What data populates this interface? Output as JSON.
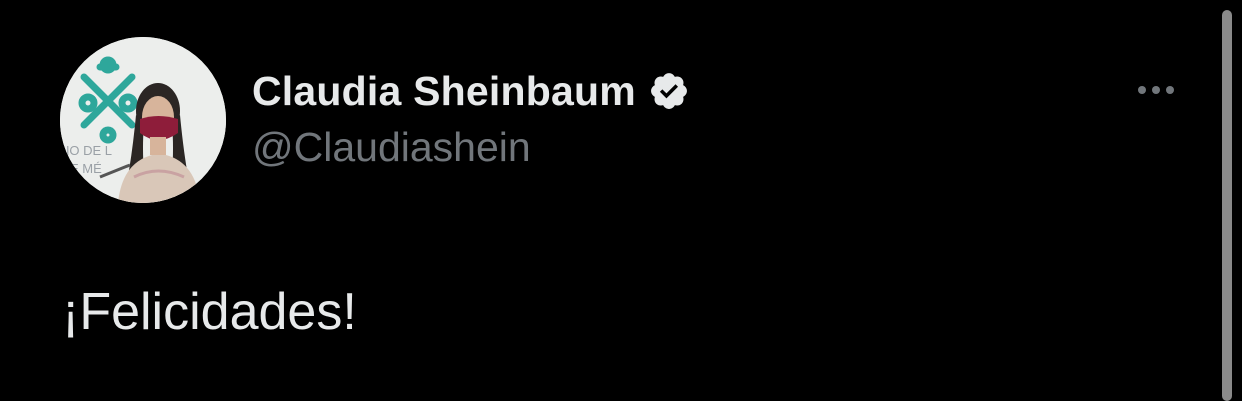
{
  "tweet": {
    "author": {
      "display_name": "Claudia Sheinbaum",
      "handle": "@Claudiashein",
      "verified": true,
      "avatar_icon": "profile-photo"
    },
    "text": "¡Felicidades!",
    "more_icon": "more-options-icon"
  },
  "colors": {
    "background": "#000000",
    "primary_text": "#e7e9ea",
    "secondary_text": "#71767b",
    "mask": "#8e1d3a",
    "logo_teal": "#2ea79b"
  }
}
